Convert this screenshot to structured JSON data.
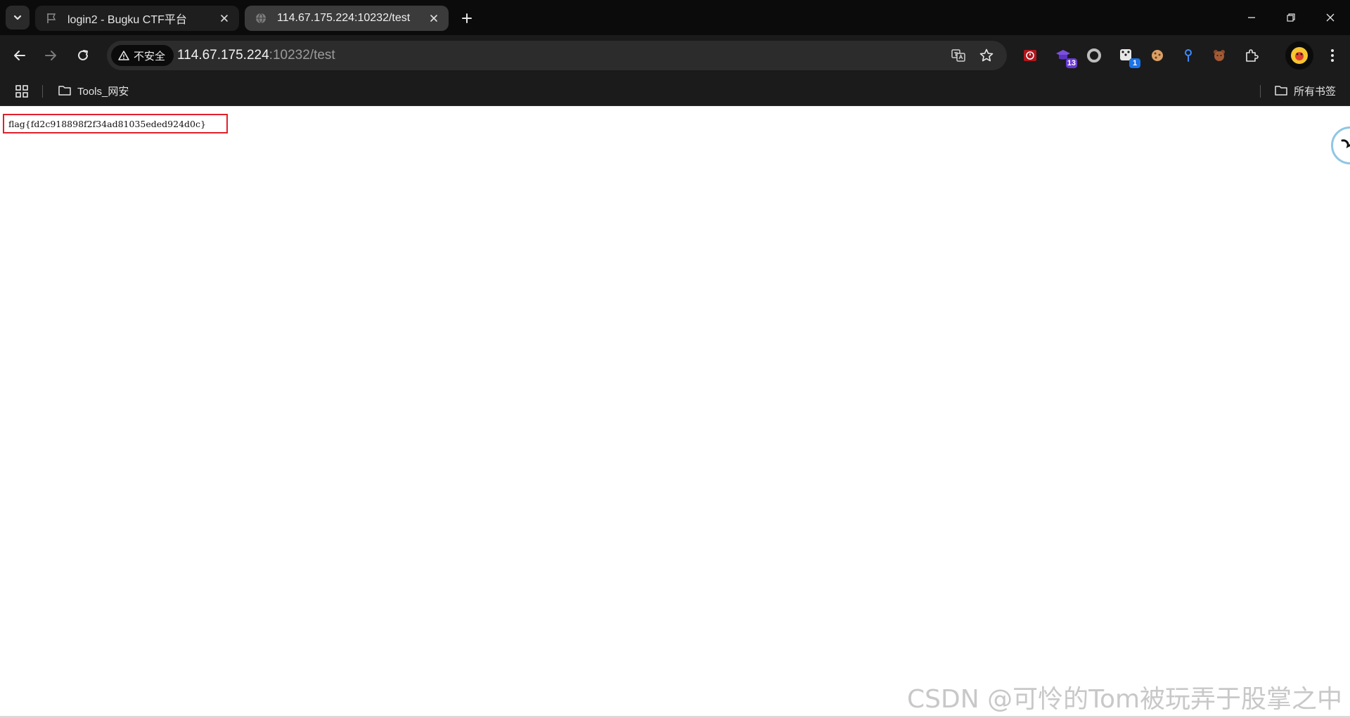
{
  "tabs": [
    {
      "title": "login2 - Bugku CTF平台",
      "favicon": "flag-icon",
      "active": false
    },
    {
      "title": "114.67.175.224:10232/test",
      "favicon": "globe-icon",
      "active": true
    }
  ],
  "omnibox": {
    "security_label": "不安全",
    "url_host": "114.67.175.224",
    "url_path": ":10232/test"
  },
  "extensions": [
    {
      "icon": "record-extension-icon",
      "badge": ""
    },
    {
      "icon": "graduation-cap-extension-icon",
      "badge": "13"
    },
    {
      "icon": "circle-extension-icon",
      "badge": ""
    },
    {
      "icon": "dice-extension-icon",
      "badge": "1"
    },
    {
      "icon": "cookie-extension-icon",
      "badge": ""
    },
    {
      "icon": "location-pin-extension-icon",
      "badge": ""
    },
    {
      "icon": "bear-extension-icon",
      "badge": ""
    },
    {
      "icon": "puzzle-extensions-icon",
      "badge": ""
    }
  ],
  "bookmarks": {
    "items": [
      {
        "label": "Tools_网安"
      }
    ],
    "all_bookmarks_label": "所有书签"
  },
  "page": {
    "flag_text": "flag{fd2c918898f2f34ad81035eded924d0c}"
  },
  "watermark": "CSDN @可怜的Tom被玩弄于股掌之中",
  "colors": {
    "highlight_border": "#e0202a",
    "tabstrip_bg": "#0b0b0b",
    "toolbar_bg": "#1b1b1b",
    "badge_purple": "#6a3ad6",
    "badge_blue": "#1a73e8"
  }
}
